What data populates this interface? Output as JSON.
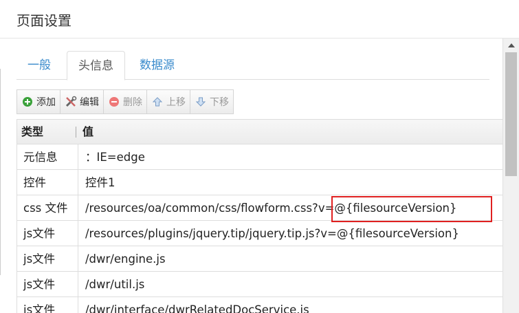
{
  "dialog": {
    "title": "页面设置"
  },
  "tabs": [
    {
      "label": "一般",
      "active": false
    },
    {
      "label": "头信息",
      "active": true
    },
    {
      "label": "数据源",
      "active": false
    }
  ],
  "toolbar": {
    "add_label": "添加",
    "edit_label": "编辑",
    "delete_label": "删除",
    "up_label": "上移",
    "down_label": "下移"
  },
  "grid": {
    "columns": [
      "类型",
      "值"
    ],
    "rows": [
      {
        "type": "元信息",
        "value": "：IE=edge"
      },
      {
        "type": "控件",
        "value": "控件1"
      },
      {
        "type": "css 文件",
        "value": "/resources/oa/common/css/flowform.css?v=@{filesourceVersion}"
      },
      {
        "type": "js文件",
        "value": "/resources/plugins/jquery.tip/jquery.tip.js?v=@{filesourceVersion}"
      },
      {
        "type": "js文件",
        "value": "/dwr/engine.js"
      },
      {
        "type": "js文件",
        "value": "/dwr/util.js"
      },
      {
        "type": "js文件",
        "value": "/dwr/interface/dwrRelatedDocService.js"
      }
    ]
  },
  "colors": {
    "accent": "#3a8bcc",
    "highlight": "#e02020"
  }
}
